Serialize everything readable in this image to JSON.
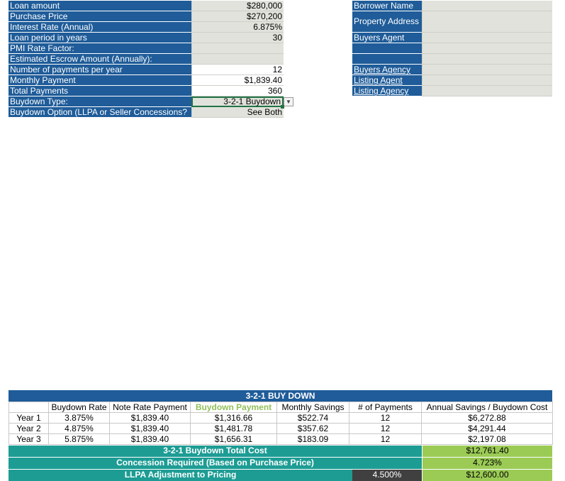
{
  "loan": {
    "rows": [
      {
        "label": "Loan amount",
        "value": "$280,000",
        "white": false
      },
      {
        "label": "Purchase Price",
        "value": "$270,200",
        "white": false
      },
      {
        "label": "Interest Rate (Annual)",
        "value": "6.875%",
        "white": false
      },
      {
        "label": "Loan period in years",
        "value": "30",
        "white": false
      },
      {
        "label": "PMI Rate Factor:",
        "value": "",
        "white": false
      },
      {
        "label": "Estimated Escrow Amount (Annually):",
        "value": "",
        "white": false
      },
      {
        "label": "Number of payments per year",
        "value": "12",
        "white": true
      },
      {
        "label": "Monthly Payment",
        "value": "$1,839.40",
        "white": true
      },
      {
        "label": "Total Payments",
        "value": "360",
        "white": true
      },
      {
        "label": "Buydown Type:",
        "value": "3-2-1 Buydown",
        "white": false
      },
      {
        "label": "Buydown Option (LLPA or Seller Concessions?",
        "value": "See Both",
        "white": false
      }
    ]
  },
  "borrower": {
    "name_label": "Borrower Name",
    "address_label": "Property Address",
    "buyers_agent_label": "Buyers Agent",
    "buyers_agency_label": "Buyers Agency",
    "listing_agent_label": "Listing Agent",
    "listing_agency_label": "Listing Agency"
  },
  "buydown": {
    "title": "3-2-1 BUY DOWN",
    "headers": [
      "",
      "Buydown Rate",
      "Note Rate Payment",
      "Buydown Payment",
      "Monthly Savings",
      "# of Payments",
      "Annual  Savings / Buydown Cost"
    ],
    "rows": [
      [
        "Year 1",
        "3.875%",
        "$1,839.40",
        "$1,316.66",
        "$522.74",
        "12",
        "$6,272.88"
      ],
      [
        "Year 2",
        "4.875%",
        "$1,839.40",
        "$1,481.78",
        "$357.62",
        "12",
        "$4,291.44"
      ],
      [
        "Year 3",
        "5.875%",
        "$1,839.40",
        "$1,656.31",
        "$183.09",
        "12",
        "$2,197.08"
      ]
    ],
    "total_cost_label": "3-2-1 Buydown Total Cost",
    "total_cost_value": "$12,761.40",
    "concession_label": "Concession Required (Based on Purchase Price)",
    "concession_value": "4.723%",
    "llpa_label": "LLPA Adjustment to Pricing",
    "llpa_pct": "4.500%",
    "llpa_value": "$12,600.00"
  },
  "icons": {
    "dropdown": "chevron-down-icon"
  }
}
